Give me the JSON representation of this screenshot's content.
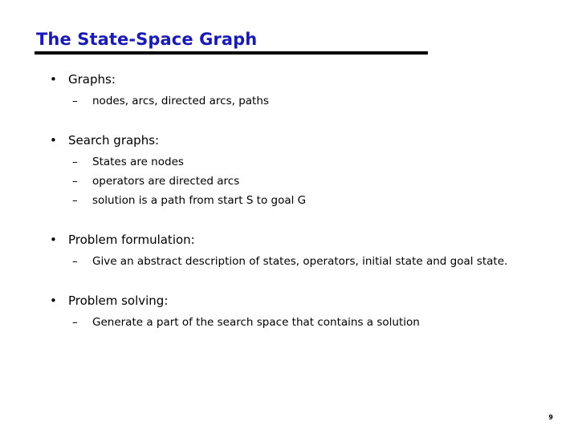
{
  "slide": {
    "title": "The State-Space Graph",
    "title_color": "#1a1ab4",
    "rule_color": "#000000",
    "background_color": "#ffffff",
    "text_color": "#000000",
    "page_number": "9",
    "bullet_marker": "•",
    "sub_marker": "–",
    "groups": [
      {
        "heading": "Graphs:",
        "items": [
          "nodes, arcs, directed arcs, paths"
        ]
      },
      {
        "heading": "Search graphs:",
        "items": [
          "States are nodes",
          "operators are directed arcs",
          "solution is a path from start S to goal G"
        ]
      },
      {
        "heading": "Problem formulation:",
        "items": [
          "Give an abstract description of states, operators, initial state and goal state."
        ]
      },
      {
        "heading": "Problem solving:",
        "items": [
          "Generate a part of the search space that contains a solution"
        ]
      }
    ]
  }
}
